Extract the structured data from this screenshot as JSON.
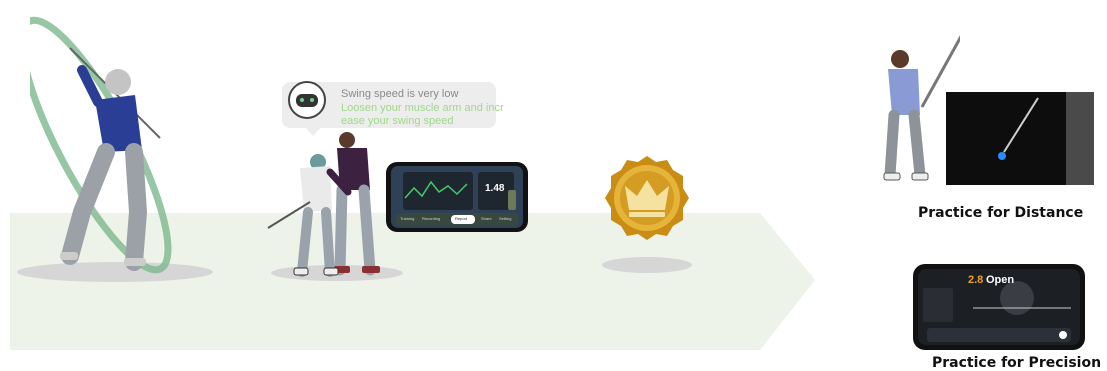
{
  "coach": {
    "line1": "Swing speed is very low",
    "line2": "Loosen your muscle arm and incr",
    "line3": "ease your swing speed"
  },
  "phone1": {
    "value": "1.48",
    "tabs": [
      "Training",
      "Recording",
      "Report",
      "Share",
      "Setting"
    ],
    "active_tab": "Report"
  },
  "phone2": {
    "value": "2.8",
    "label": "Open"
  },
  "captions": {
    "distance": "Practice for Distance",
    "precision": "Practice for Precision"
  },
  "colors": {
    "path": "#edf3e8",
    "ring": "#7cb88c",
    "coin": "#e6b43a",
    "accent_green": "#9fd88a"
  },
  "icons": {
    "coach": "robot-face-icon",
    "reward": "crown-coin-icon"
  }
}
